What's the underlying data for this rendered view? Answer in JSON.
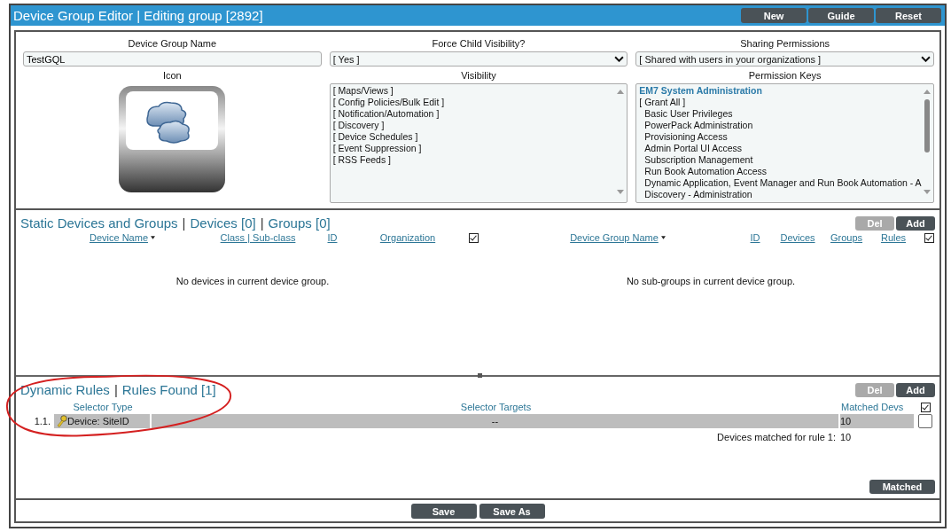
{
  "window": {
    "title": "Device Group Editor | Editing group [2892]",
    "buttons": [
      "New",
      "Guide",
      "Reset"
    ]
  },
  "fields": [
    {
      "label": "Device Group Name",
      "kind": "text",
      "value": "TestGQL"
    },
    {
      "label": "Force Child Visibility?",
      "kind": "select",
      "value": "[ Yes ]"
    },
    {
      "label": "Sharing Permissions",
      "kind": "select",
      "value": "[ Shared with users in your organizations ]"
    }
  ],
  "icon": {
    "label": "Icon"
  },
  "visibility": {
    "label": "Visibility",
    "items": [
      "[ Maps/Views ]",
      "[ Config Policies/Bulk Edit ]",
      "[ Notification/Automation ]",
      "[ Discovery ]",
      "[ Device Schedules ]",
      "[ Event Suppression ]",
      "[ RSS Feeds ]"
    ]
  },
  "permission_keys": {
    "label": "Permission Keys",
    "items": [
      {
        "kind": "category",
        "text": "EM7 System Administration"
      },
      {
        "kind": "option",
        "text": "[ Grant All ]"
      },
      {
        "kind": "sub",
        "text": "Basic User Privileges"
      },
      {
        "kind": "sub",
        "text": "PowerPack Administration"
      },
      {
        "kind": "sub",
        "text": "Provisioning Access"
      },
      {
        "kind": "sub",
        "text": "Admin Portal UI Access"
      },
      {
        "kind": "sub",
        "text": "Subscription Management"
      },
      {
        "kind": "sub",
        "text": "Run Book Automation Access"
      },
      {
        "kind": "sub",
        "text": "Dynamic Application, Event Manager and Run Book Automation - A"
      },
      {
        "kind": "sub",
        "text": "Discovery - Administration"
      }
    ]
  },
  "static": {
    "title_parts": [
      {
        "kind": "label",
        "text": "Static Devices and Groups"
      },
      {
        "kind": "separator",
        "text": "|"
      },
      {
        "kind": "label",
        "text": "Devices [0]"
      },
      {
        "kind": "separator",
        "text": "|"
      },
      {
        "kind": "label",
        "text": "Groups [0]"
      }
    ],
    "buttons": [
      {
        "label": "Del",
        "disabled": true
      },
      {
        "label": "Add",
        "disabled": false
      }
    ],
    "devices_table": {
      "columns": [
        {
          "label": "Device Name",
          "sorted": true
        },
        {
          "label": "Class | Sub-class",
          "sorted": false
        },
        {
          "label": "ID",
          "sorted": false
        },
        {
          "label": "Organization",
          "sorted": false
        }
      ],
      "select_all_checked": true,
      "empty_message": "No devices in current device group."
    },
    "groups_table": {
      "columns": [
        {
          "label": "Device Group Name",
          "sorted": true
        },
        {
          "label": "ID",
          "sorted": false
        },
        {
          "label": "Devices",
          "sorted": false
        },
        {
          "label": "Groups",
          "sorted": false
        },
        {
          "label": "Rules",
          "sorted": false
        }
      ],
      "select_all_checked": true,
      "empty_message": "No sub-groups in current device group."
    }
  },
  "dynamic": {
    "title_parts": [
      {
        "kind": "label",
        "text": "Dynamic Rules"
      },
      {
        "kind": "separator",
        "text": "|"
      },
      {
        "kind": "label",
        "text": "Rules Found [1]"
      }
    ],
    "buttons": [
      {
        "label": "Del",
        "disabled": true
      },
      {
        "label": "Add",
        "disabled": false
      }
    ],
    "columns": [
      "Selector Type",
      "Selector Targets",
      "Matched Devs"
    ],
    "select_all_checked": true,
    "rows": [
      {
        "index": "1.1.",
        "selector_type": "Device: SiteID",
        "selector_targets": "--",
        "matched_devs": "10",
        "checked": false
      }
    ],
    "summary": {
      "label": "Devices matched for rule 1:",
      "value": "10"
    },
    "matched_button": "Matched"
  },
  "footer": {
    "buttons": [
      "Save",
      "Save As"
    ]
  }
}
